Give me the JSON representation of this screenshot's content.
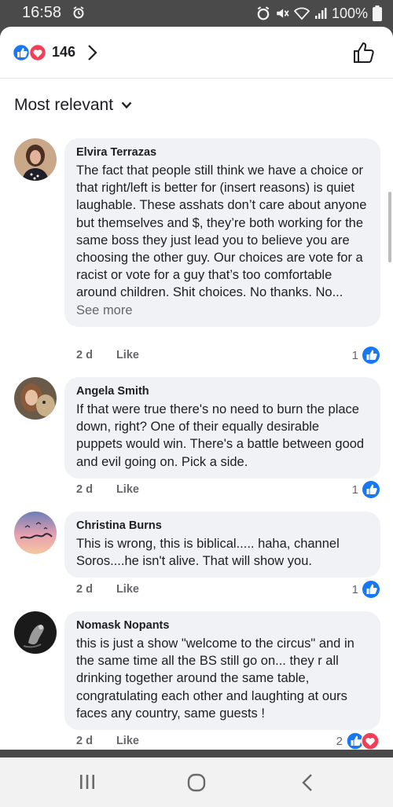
{
  "status_bar": {
    "time": "16:58",
    "battery": "100%"
  },
  "reactions": {
    "count": "146"
  },
  "sort": {
    "label": "Most relevant"
  },
  "comments": [
    {
      "author": "Elvira Terrazas",
      "text": "The fact that people still think we have a choice or that right/left is better for (insert reasons) is quiet laughable. These asshats don’t care about anyone but themselves and $, they’re both working for the same boss they just lead you to believe you are choosing the other guy. Our choices are vote for a racist or vote for a guy that’s too comfortable around children. Shit choices. No thanks. No...",
      "see_more": "See more",
      "time": "2 d",
      "like": "Like",
      "reaction_count": "1"
    },
    {
      "author": "Angela Smith",
      "text": "If that were true there's no need to burn the place down, right? One of their equally desirable puppets would win. There's a battle between good and evil going on. Pick a side.",
      "time": "2 d",
      "like": "Like",
      "reaction_count": "1"
    },
    {
      "author": "Christina Burns",
      "text": "This is wrong, this is biblical..... haha, channel Soros....he isn't alive. That will show you.",
      "time": "2 d",
      "like": "Like",
      "reaction_count": "1"
    },
    {
      "author": "Nomask Nopants",
      "text": "this is just a show \"welcome to the circus\" and in the same time all the BS still go on... they r all drinking together around the same table, congratulating each other and laughting at ours faces any country, same guests !",
      "time": "2 d",
      "like": "Like",
      "reaction_count": "2"
    }
  ],
  "colors": {
    "facebook_blue": "#1877f2",
    "love_red": "#f33e58",
    "bubble_bg": "#f0f2f5",
    "meta_gray": "#65676b"
  }
}
